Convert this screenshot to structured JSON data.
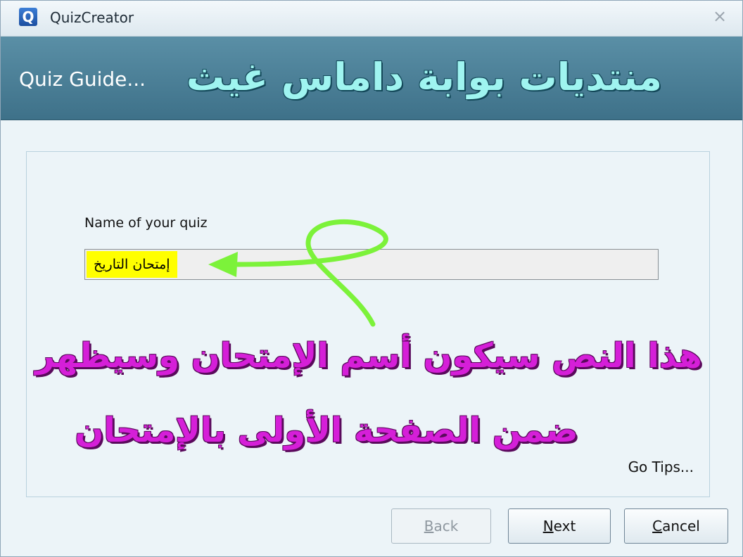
{
  "window": {
    "title": "QuizCreator",
    "close_label": "×"
  },
  "header": {
    "guide_title": "Quiz Guide...",
    "forum_banner": "منتديات بوابة داماس غيث"
  },
  "form": {
    "name_label": "Name of your quiz",
    "quiz_name_value": "إمتحان التاريخ"
  },
  "annotation": {
    "line1": "هذا النص سيكون أسم الإمتحان وسيظهر",
    "line2": "ضمن الصفحة الأولى بالإمتحان"
  },
  "tips": {
    "go_tips": "Go Tips..."
  },
  "buttons": {
    "back_first": "B",
    "back_rest": "ack",
    "next_first": "N",
    "next_rest": "ext",
    "cancel_first": "C",
    "cancel_rest": "ancel"
  },
  "colors": {
    "header": "#4a8098",
    "annotation": "#d51fd8",
    "highlight": "#ffff00",
    "arrow": "#7cf23a"
  }
}
